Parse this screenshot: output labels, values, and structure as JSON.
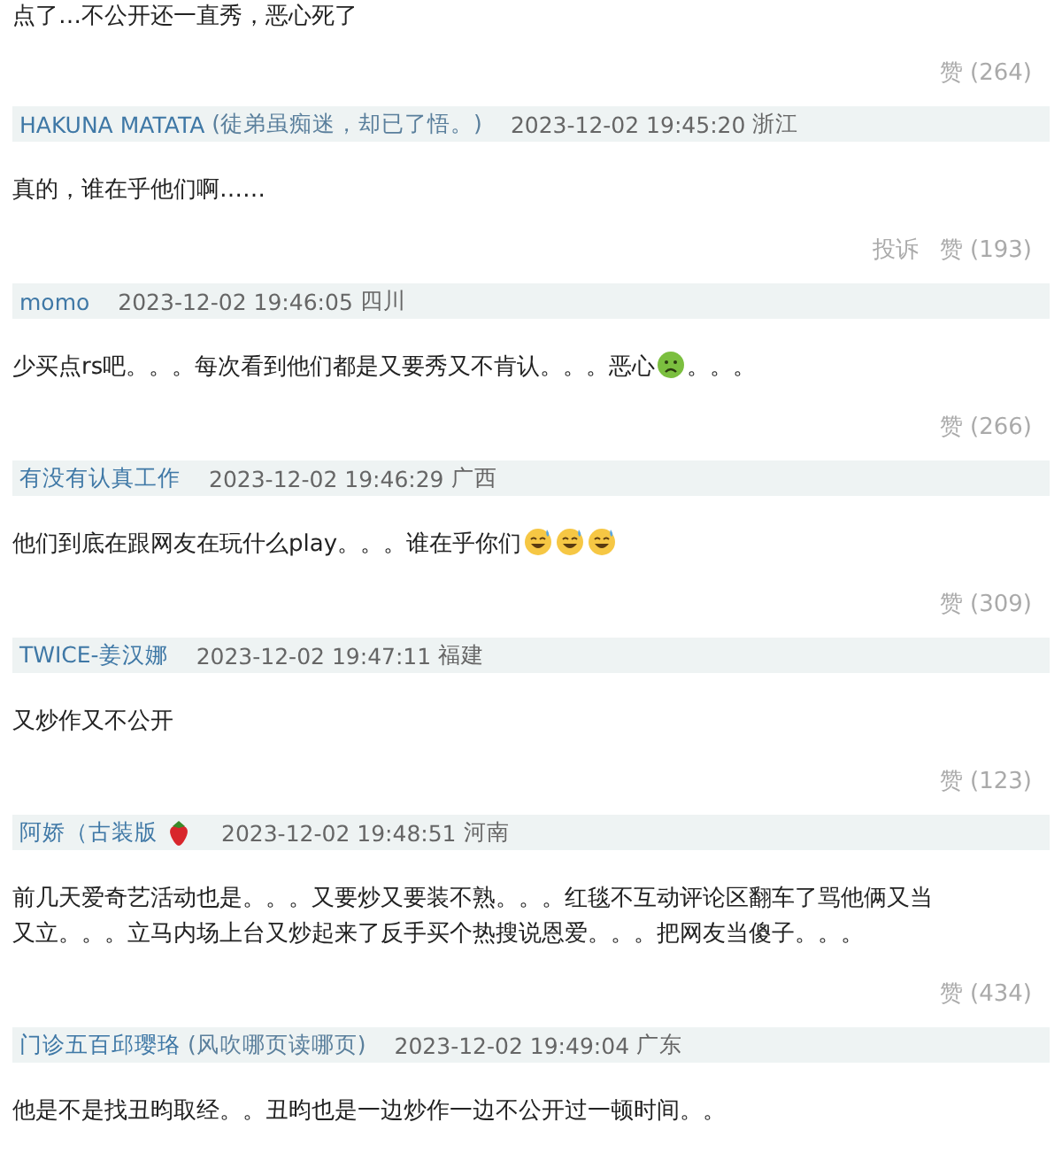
{
  "leading": {
    "body": [
      {
        "kind": "text",
        "text": "点了…不公开还一直秀，恶心死了"
      }
    ],
    "actions": [
      "赞 (264)"
    ]
  },
  "comments": [
    {
      "author": "HAKUNA MATATA",
      "author_note": "(徒弟虽痴迷，却已了悟。)",
      "time": "2023-12-02 19:45:20",
      "location": "浙江",
      "body": [
        {
          "kind": "text",
          "text": "真的，谁在乎他们啊……"
        }
      ],
      "actions": [
        "投诉",
        "赞 (193)"
      ]
    },
    {
      "author": "momo",
      "time": "2023-12-02 19:46:05",
      "location": "四川",
      "body": [
        {
          "kind": "text",
          "text": "少买点rs吧。。。每次看到他们都是又要秀又不肯认。。。恶心"
        },
        {
          "kind": "sick_emoji"
        },
        {
          "kind": "text",
          "text": "。。。"
        }
      ],
      "actions": [
        "赞 (266)"
      ]
    },
    {
      "author": "有没有认真工作",
      "time": "2023-12-02 19:46:29",
      "location": "广西",
      "body": [
        {
          "kind": "text",
          "text": "他们到底在跟网友在玩什么play。。。谁在乎你们"
        },
        {
          "kind": "sweat_emoji"
        },
        {
          "kind": "sweat_emoji"
        },
        {
          "kind": "sweat_emoji"
        }
      ],
      "actions": [
        "赞 (309)"
      ]
    },
    {
      "author": "TWICE-姜汉娜",
      "time": "2023-12-02 19:47:11",
      "location": "福建",
      "body": [
        {
          "kind": "text",
          "text": "又炒作又不公开"
        }
      ],
      "actions": [
        "赞 (123)"
      ]
    },
    {
      "author": "阿娇（古装版",
      "badge": {
        "kind": "strawberry"
      },
      "time": "2023-12-02 19:48:51",
      "location": "河南",
      "body": [
        {
          "kind": "text",
          "text": "前几天爱奇艺活动也是。。。又要炒又要装不熟。。。红毯不互动评论区翻车了骂他俩又当又立。。。立马内场上台又炒起来了反手买个热搜说恩爱。。。把网友当傻子。。。"
        }
      ],
      "actions": [
        "赞 (434)"
      ]
    },
    {
      "author": "门诊五百邱璎珞",
      "author_note": "(风吹哪页读哪页)",
      "time": "2023-12-02 19:49:04",
      "location": "广东",
      "body": [
        {
          "kind": "text",
          "text": "他是不是找丑昀取经。。丑昀也是一边炒作一边不公开过一顿时间。。"
        }
      ]
    }
  ]
}
